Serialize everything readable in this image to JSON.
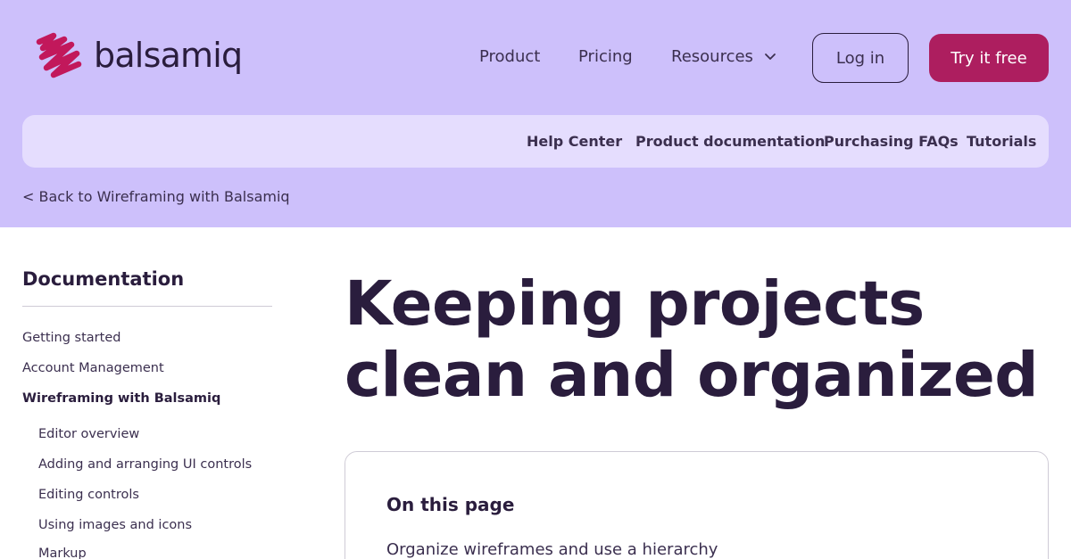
{
  "brand": {
    "name": "balsamiq",
    "logo_color": "#c2185b"
  },
  "nav": {
    "product": "Product",
    "pricing": "Pricing",
    "resources": "Resources",
    "login": "Log in",
    "try_free": "Try it free"
  },
  "subnav": {
    "items": [
      "Help Center",
      "Product documentation",
      "Purchasing FAQs",
      "Tutorials"
    ]
  },
  "breadcrumb": {
    "back": "< Back to Wireframing with Balsamiq"
  },
  "sidebar": {
    "title": "Documentation",
    "items": [
      "Getting started",
      "Account Management",
      "Wireframing with Balsamiq"
    ],
    "active_item": "Wireframing with Balsamiq",
    "subitems": [
      "Editor overview",
      "Adding and arranging UI controls",
      "Editing controls",
      "Using images and icons",
      "Markup"
    ]
  },
  "main": {
    "title": "Keeping projects clean and organized",
    "toc_title": "On this page",
    "toc_items": [
      "Organize wireframes and use a hierarchy"
    ]
  },
  "colors": {
    "hero_bg": "#cdc0fb",
    "subnav_bg": "#e5ddfe",
    "primary_button": "#ad1e5f",
    "text_dark": "#2a1d3d"
  },
  "icons": {
    "logo": "balsamiq-squiggle-icon",
    "resources_dropdown": "chevron-down-icon"
  }
}
